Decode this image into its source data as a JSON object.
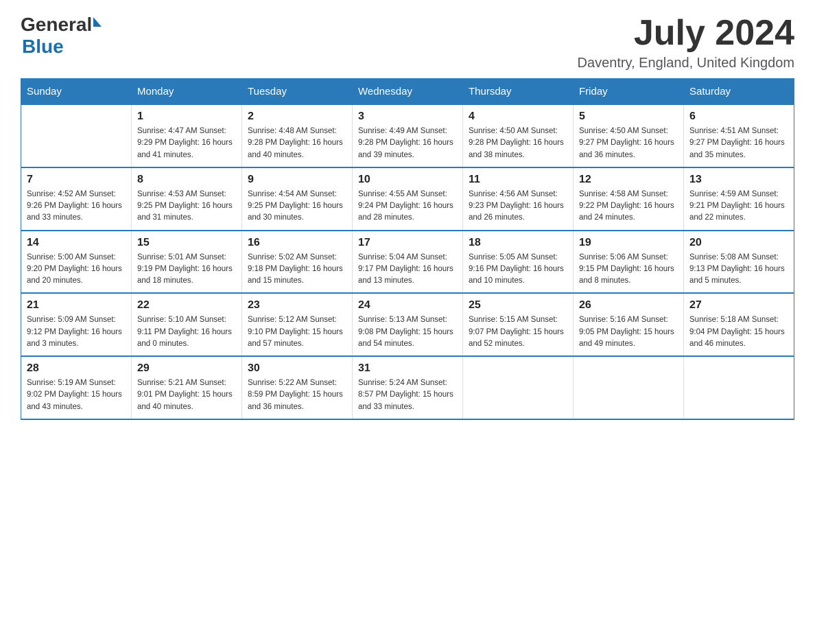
{
  "header": {
    "logo": {
      "general": "General",
      "triangle": "▶",
      "blue": "Blue"
    },
    "title": "July 2024",
    "location": "Daventry, England, United Kingdom"
  },
  "columns": [
    "Sunday",
    "Monday",
    "Tuesday",
    "Wednesday",
    "Thursday",
    "Friday",
    "Saturday"
  ],
  "weeks": [
    [
      {
        "day": "",
        "info": ""
      },
      {
        "day": "1",
        "info": "Sunrise: 4:47 AM\nSunset: 9:29 PM\nDaylight: 16 hours\nand 41 minutes."
      },
      {
        "day": "2",
        "info": "Sunrise: 4:48 AM\nSunset: 9:28 PM\nDaylight: 16 hours\nand 40 minutes."
      },
      {
        "day": "3",
        "info": "Sunrise: 4:49 AM\nSunset: 9:28 PM\nDaylight: 16 hours\nand 39 minutes."
      },
      {
        "day": "4",
        "info": "Sunrise: 4:50 AM\nSunset: 9:28 PM\nDaylight: 16 hours\nand 38 minutes."
      },
      {
        "day": "5",
        "info": "Sunrise: 4:50 AM\nSunset: 9:27 PM\nDaylight: 16 hours\nand 36 minutes."
      },
      {
        "day": "6",
        "info": "Sunrise: 4:51 AM\nSunset: 9:27 PM\nDaylight: 16 hours\nand 35 minutes."
      }
    ],
    [
      {
        "day": "7",
        "info": "Sunrise: 4:52 AM\nSunset: 9:26 PM\nDaylight: 16 hours\nand 33 minutes."
      },
      {
        "day": "8",
        "info": "Sunrise: 4:53 AM\nSunset: 9:25 PM\nDaylight: 16 hours\nand 31 minutes."
      },
      {
        "day": "9",
        "info": "Sunrise: 4:54 AM\nSunset: 9:25 PM\nDaylight: 16 hours\nand 30 minutes."
      },
      {
        "day": "10",
        "info": "Sunrise: 4:55 AM\nSunset: 9:24 PM\nDaylight: 16 hours\nand 28 minutes."
      },
      {
        "day": "11",
        "info": "Sunrise: 4:56 AM\nSunset: 9:23 PM\nDaylight: 16 hours\nand 26 minutes."
      },
      {
        "day": "12",
        "info": "Sunrise: 4:58 AM\nSunset: 9:22 PM\nDaylight: 16 hours\nand 24 minutes."
      },
      {
        "day": "13",
        "info": "Sunrise: 4:59 AM\nSunset: 9:21 PM\nDaylight: 16 hours\nand 22 minutes."
      }
    ],
    [
      {
        "day": "14",
        "info": "Sunrise: 5:00 AM\nSunset: 9:20 PM\nDaylight: 16 hours\nand 20 minutes."
      },
      {
        "day": "15",
        "info": "Sunrise: 5:01 AM\nSunset: 9:19 PM\nDaylight: 16 hours\nand 18 minutes."
      },
      {
        "day": "16",
        "info": "Sunrise: 5:02 AM\nSunset: 9:18 PM\nDaylight: 16 hours\nand 15 minutes."
      },
      {
        "day": "17",
        "info": "Sunrise: 5:04 AM\nSunset: 9:17 PM\nDaylight: 16 hours\nand 13 minutes."
      },
      {
        "day": "18",
        "info": "Sunrise: 5:05 AM\nSunset: 9:16 PM\nDaylight: 16 hours\nand 10 minutes."
      },
      {
        "day": "19",
        "info": "Sunrise: 5:06 AM\nSunset: 9:15 PM\nDaylight: 16 hours\nand 8 minutes."
      },
      {
        "day": "20",
        "info": "Sunrise: 5:08 AM\nSunset: 9:13 PM\nDaylight: 16 hours\nand 5 minutes."
      }
    ],
    [
      {
        "day": "21",
        "info": "Sunrise: 5:09 AM\nSunset: 9:12 PM\nDaylight: 16 hours\nand 3 minutes."
      },
      {
        "day": "22",
        "info": "Sunrise: 5:10 AM\nSunset: 9:11 PM\nDaylight: 16 hours\nand 0 minutes."
      },
      {
        "day": "23",
        "info": "Sunrise: 5:12 AM\nSunset: 9:10 PM\nDaylight: 15 hours\nand 57 minutes."
      },
      {
        "day": "24",
        "info": "Sunrise: 5:13 AM\nSunset: 9:08 PM\nDaylight: 15 hours\nand 54 minutes."
      },
      {
        "day": "25",
        "info": "Sunrise: 5:15 AM\nSunset: 9:07 PM\nDaylight: 15 hours\nand 52 minutes."
      },
      {
        "day": "26",
        "info": "Sunrise: 5:16 AM\nSunset: 9:05 PM\nDaylight: 15 hours\nand 49 minutes."
      },
      {
        "day": "27",
        "info": "Sunrise: 5:18 AM\nSunset: 9:04 PM\nDaylight: 15 hours\nand 46 minutes."
      }
    ],
    [
      {
        "day": "28",
        "info": "Sunrise: 5:19 AM\nSunset: 9:02 PM\nDaylight: 15 hours\nand 43 minutes."
      },
      {
        "day": "29",
        "info": "Sunrise: 5:21 AM\nSunset: 9:01 PM\nDaylight: 15 hours\nand 40 minutes."
      },
      {
        "day": "30",
        "info": "Sunrise: 5:22 AM\nSunset: 8:59 PM\nDaylight: 15 hours\nand 36 minutes."
      },
      {
        "day": "31",
        "info": "Sunrise: 5:24 AM\nSunset: 8:57 PM\nDaylight: 15 hours\nand 33 minutes."
      },
      {
        "day": "",
        "info": ""
      },
      {
        "day": "",
        "info": ""
      },
      {
        "day": "",
        "info": ""
      }
    ]
  ]
}
